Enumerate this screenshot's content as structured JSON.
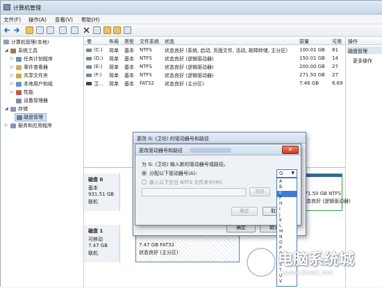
{
  "window": {
    "title": "计算机管理",
    "menu": [
      "文件(F)",
      "操作(A)",
      "查看(V)",
      "帮助(H)"
    ]
  },
  "tree": {
    "root": "计算机管理(本地)",
    "system_tools": "系统工具",
    "items": [
      "任务计划程序",
      "事件查看器",
      "共享文件夹",
      "本地用户和组",
      "性能",
      "设备管理器"
    ],
    "storage": "存储",
    "disk_mgmt": "磁盘管理",
    "services": "服务和应用程序"
  },
  "table": {
    "headers": [
      "卷",
      "布局",
      "类型",
      "文件系统",
      "状态",
      "容量",
      "可用"
    ],
    "rows": [
      {
        "vol": "(C:)",
        "layout": "简单",
        "type": "基本",
        "fs": "NTFS",
        "status": "状态良好 (系统, 启动, 页面文件, 活动, 故障转储, 主分区)",
        "cap": "100.01 GB",
        "free": "81"
      },
      {
        "vol": "(D:)",
        "layout": "简单",
        "type": "基本",
        "fs": "NTFS",
        "status": "状态良好 (逻辑驱动器)",
        "cap": "150.01 GB",
        "free": "14"
      },
      {
        "vol": "(E:)",
        "layout": "简单",
        "type": "基本",
        "fs": "NTFS",
        "status": "状态良好 (逻辑驱动器)",
        "cap": "200.00 GB",
        "free": "27"
      },
      {
        "vol": "(F:)",
        "layout": "简单",
        "type": "基本",
        "fs": "NTFS",
        "status": "状态良好 (逻辑驱动器)",
        "cap": "271.50 GB",
        "free": "27"
      },
      {
        "vol": "卫...",
        "layout": "简单",
        "type": "基本",
        "fs": "FAT32",
        "status": "状态良好 (主分区)",
        "cap": "7.46 GB",
        "free": "6.69"
      }
    ]
  },
  "actions": {
    "header": "操作",
    "section": "磁盘管理",
    "more": "更多操作"
  },
  "disks": [
    {
      "name": "磁盘 0",
      "type": "基本",
      "size": "931.51 GB",
      "state": "联机",
      "part_size": "271.50 GB NTFS",
      "part_state": "状态良好 (逻辑驱动器)"
    },
    {
      "name": "磁盘 1",
      "type": "可移动",
      "size": "7.47 GB",
      "state": "联机",
      "part_size": "7.47 GB FAT32",
      "part_state": "状态良好 (主分区)"
    }
  ],
  "dialog_outer": {
    "title": "更改 G: (卫坊) 的驱动器号和路径",
    "ok": "确定",
    "cancel": "取消"
  },
  "dialog_inner": {
    "title": "更改驱动器号和路径",
    "prompt": "为 G: (卫坊) 输入新的驱动器号或路径。",
    "option1": "分配以下驱动器号(A):",
    "option2": "装入以下空白 NTFS 文件夹中(M):",
    "browse": "浏览",
    "ok": "确定",
    "cancel": "取消",
    "selected_letter": "G"
  },
  "letters": [
    "A",
    "B",
    "E",
    "F",
    "H",
    "I",
    "J",
    "K",
    "L",
    "M",
    "N",
    "O",
    "P",
    "Q",
    "R",
    "S",
    "T",
    "U",
    "V",
    "W"
  ],
  "watermark": {
    "text": "电脑系统城",
    "url": "www.dnxtc.net"
  },
  "colors": {
    "selection": "#3d7bd6",
    "partition_bar": "#3463a6",
    "close_button": "#c8371f"
  }
}
